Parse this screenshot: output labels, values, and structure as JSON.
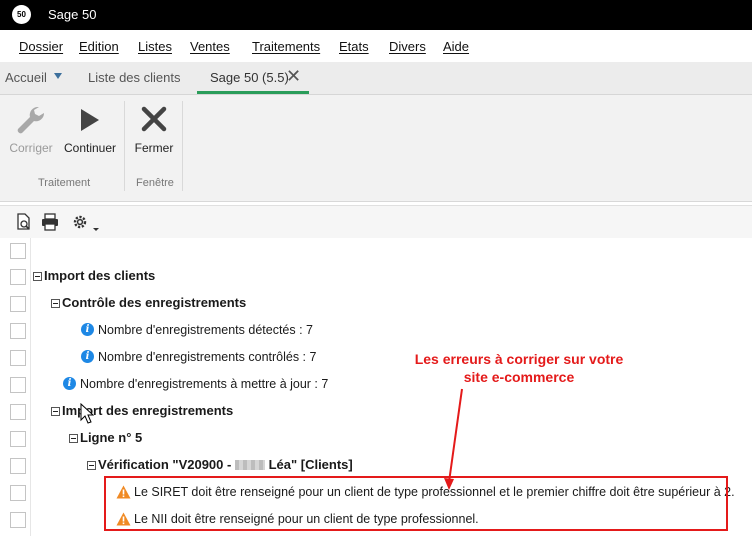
{
  "window": {
    "title": "Sage 50",
    "logo_text": "50"
  },
  "menu": {
    "items": [
      {
        "label": "Dossier",
        "name": "menu-dossier"
      },
      {
        "label": "Edition",
        "name": "menu-edition"
      },
      {
        "label": "Listes",
        "name": "menu-listes"
      },
      {
        "label": "Ventes",
        "name": "menu-ventes"
      },
      {
        "label": "Traitements",
        "name": "menu-traitements"
      },
      {
        "label": "Etats",
        "name": "menu-etats"
      },
      {
        "label": "Divers",
        "name": "menu-divers"
      },
      {
        "label": "Aide",
        "name": "menu-aide"
      }
    ]
  },
  "tabs": {
    "home": "Accueil",
    "clients": "Liste des clients",
    "active": "Sage 50 (5.5)"
  },
  "ribbon": {
    "corriger": "Corriger",
    "continuer": "Continuer",
    "fermer": "Fermer",
    "group_traitement": "Traitement",
    "group_fenetre": "Fenêtre"
  },
  "tree": {
    "import_clients": "Import des clients",
    "controle": "Contrôle des enregistrements",
    "detectes": "Nombre d'enregistrements détectés : 7",
    "controles": "Nombre d'enregistrements contrôlés : 7",
    "a_mettre_a_jour": "Nombre d'enregistrements à mettre à jour : 7",
    "import_enreg": "Import des enregistrements",
    "ligne": "Ligne n° 5",
    "verification_prefix": "Vérification \"V20900 - ",
    "verification_suffix": " Léa\" [Clients]",
    "error_siret": "Le SIRET doit être renseigné pour un client de type professionnel et le premier chiffre doit être supérieur à 2.",
    "error_nii": "Le NII doit être renseigné pour un client de type professionnel."
  },
  "annotation": {
    "line1": "Les erreurs à corriger sur votre",
    "line2": "site e-commerce"
  },
  "colors": {
    "accent_green": "#2a9d5a",
    "annotation_red": "#e41a1a",
    "info_blue": "#1e88e5",
    "warning_orange": "#f08a24"
  }
}
